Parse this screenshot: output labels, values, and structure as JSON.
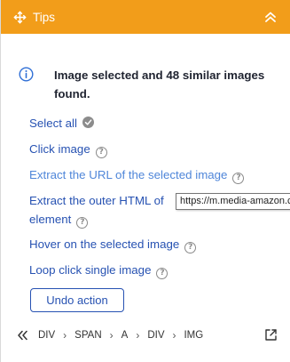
{
  "header": {
    "title": "Tips",
    "accent": "#f29d1a"
  },
  "notice": {
    "text": "Image selected and 48 similar images found.",
    "icon": "info-icon"
  },
  "actions": [
    {
      "label": "Select all",
      "badge": "check-circle-icon"
    },
    {
      "label": "Click image",
      "badge": "help-icon"
    },
    {
      "label": "Extract the URL of the selected image",
      "badge": "help-icon"
    },
    {
      "label": "Extract the outer HTML of",
      "label2": "element",
      "badge": "help-icon"
    },
    {
      "label": "Hover on the selected image",
      "badge": "help-icon"
    },
    {
      "label": "Loop click single image",
      "badge": "help-icon"
    }
  ],
  "tooltip": "https://m.media-amazon.com",
  "undo_label": "Undo action",
  "breadcrumb": [
    "DIV",
    "SPAN",
    "A",
    "DIV",
    "IMG"
  ],
  "colors": {
    "link": "#2752b2",
    "link_light": "#4f86d9",
    "header": "#f29d1a"
  }
}
